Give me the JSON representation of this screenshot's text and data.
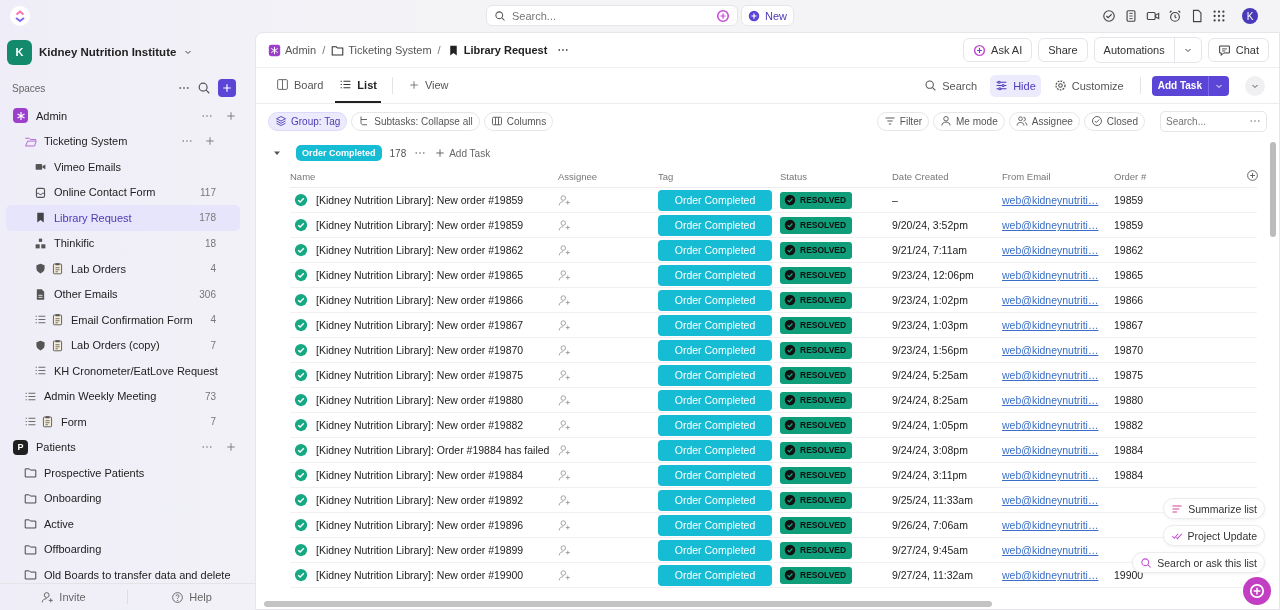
{
  "topbar": {
    "search_placeholder": "Search...",
    "new_button": "New",
    "avatar": "K"
  },
  "workspace": {
    "initial": "K",
    "name": "Kidney Nutrition Institute"
  },
  "sidebar": {
    "section": "Spaces",
    "spaces": [
      {
        "name": "Admin",
        "color": "#9c3fcb",
        "children": [
          {
            "label": "Ticketing System",
            "kind": "folder",
            "expanded": true,
            "selected": false,
            "children": [
              {
                "label": "Vimeo Emails",
                "kind": "video",
                "selected": false
              },
              {
                "label": "Online Contact Form",
                "kind": "inbox",
                "count": "117",
                "selected": false
              },
              {
                "label": "Library Request",
                "kind": "bookmark",
                "count": "178",
                "selected": true
              },
              {
                "label": "Thinkific",
                "kind": "tree",
                "count": "18",
                "selected": false
              },
              {
                "label": "Lab Orders",
                "kind": "shield",
                "form": true,
                "count": "4",
                "selected": false
              },
              {
                "label": "Other Emails",
                "kind": "doc",
                "count": "306",
                "selected": false
              },
              {
                "label": "Email Confirmation Form",
                "kind": "list",
                "form": true,
                "count": "4",
                "selected": false
              },
              {
                "label": "Lab Orders (copy)",
                "kind": "shield",
                "form": true,
                "count": "7",
                "selected": false
              },
              {
                "label": "KH Cronometer/EatLove Request",
                "kind": "list",
                "selected": false
              }
            ]
          },
          {
            "label": "Admin Weekly Meeting",
            "kind": "list",
            "count": "73",
            "selected": false
          },
          {
            "label": "Form",
            "kind": "list",
            "form": true,
            "count": "7",
            "selected": false
          }
        ]
      },
      {
        "name": "Patients",
        "initial": "P",
        "color": "#202020",
        "children": [
          {
            "label": "Prospective Patients",
            "kind": "folder",
            "selected": false
          },
          {
            "label": "Onboarding",
            "kind": "folder",
            "selected": false
          },
          {
            "label": "Active",
            "kind": "folder",
            "selected": false
          },
          {
            "label": "Offboarding",
            "kind": "folder",
            "selected": false
          },
          {
            "label": "Old Boards to transfer data and delete",
            "kind": "folder",
            "selected": false
          }
        ]
      }
    ]
  },
  "footer": {
    "invite": "Invite",
    "help": "Help"
  },
  "breadcrumbs": [
    {
      "label": "Admin",
      "kind": "space"
    },
    {
      "label": "Ticketing System",
      "kind": "folder"
    },
    {
      "label": "Library Request",
      "kind": "bookmark"
    }
  ],
  "breadcrumb_separator": "/",
  "header_buttons": [
    {
      "label": "Ask AI",
      "kind": "ai"
    },
    {
      "label": "Share",
      "kind": "plain"
    },
    {
      "label": "Automations",
      "kind": "split"
    },
    {
      "label": "Chat",
      "kind": "chat"
    }
  ],
  "views": [
    {
      "label": "Board",
      "kind": "board",
      "selected": false
    },
    {
      "label": "List",
      "kind": "list",
      "selected": true
    }
  ],
  "add_view": "View",
  "view_actions": [
    {
      "label": "Search",
      "kind": "search",
      "selected": false
    },
    {
      "label": "Hide",
      "kind": "sliders",
      "selected": true
    },
    {
      "label": "Customize",
      "kind": "gear",
      "selected": false
    }
  ],
  "add_task_button": "Add Task",
  "filters_left": [
    {
      "label": "Group: Tag",
      "kind": "layers",
      "selected": true
    },
    {
      "label": "Subtasks: Collapse all",
      "kind": "subtasks",
      "selected": false
    },
    {
      "label": "Columns",
      "kind": "columns",
      "selected": false
    }
  ],
  "filters_right": [
    {
      "label": "Filter",
      "kind": "filter"
    },
    {
      "label": "Me mode",
      "kind": "person"
    },
    {
      "label": "Assignee",
      "kind": "people"
    },
    {
      "label": "Closed",
      "kind": "check"
    }
  ],
  "list_search_placeholder": "Search...",
  "group": {
    "label": "Order Completed",
    "count": "178",
    "add": "Add Task"
  },
  "columns": [
    "Name",
    "Assignee",
    "Tag",
    "Status",
    "Date Created",
    "From Email",
    "Order #"
  ],
  "rows": [
    {
      "name": "[Kidney Nutrition Library]: New order #19859",
      "tag": "Order Completed",
      "status": "RESOLVED",
      "date": "–",
      "email": "web@kidneynutriti…",
      "order": "19859"
    },
    {
      "name": "[Kidney Nutrition Library]: New order #19859",
      "tag": "Order Completed",
      "status": "RESOLVED",
      "date": "9/20/24, 3:52pm",
      "email": "web@kidneynutriti…",
      "order": "19859"
    },
    {
      "name": "[Kidney Nutrition Library]: New order #19862",
      "tag": "Order Completed",
      "status": "RESOLVED",
      "date": "9/21/24, 7:11am",
      "email": "web@kidneynutriti…",
      "order": "19862"
    },
    {
      "name": "[Kidney Nutrition Library]: New order #19865",
      "tag": "Order Completed",
      "status": "RESOLVED",
      "date": "9/23/24, 12:06pm",
      "email": "web@kidneynutriti…",
      "order": "19865"
    },
    {
      "name": "[Kidney Nutrition Library]: New order #19866",
      "tag": "Order Completed",
      "status": "RESOLVED",
      "date": "9/23/24, 1:02pm",
      "email": "web@kidneynutriti…",
      "order": "19866"
    },
    {
      "name": "[Kidney Nutrition Library]: New order #19867",
      "tag": "Order Completed",
      "status": "RESOLVED",
      "date": "9/23/24, 1:03pm",
      "email": "web@kidneynutriti…",
      "order": "19867"
    },
    {
      "name": "[Kidney Nutrition Library]: New order #19870",
      "tag": "Order Completed",
      "status": "RESOLVED",
      "date": "9/23/24, 1:56pm",
      "email": "web@kidneynutriti…",
      "order": "19870"
    },
    {
      "name": "[Kidney Nutrition Library]: New order #19875",
      "tag": "Order Completed",
      "status": "RESOLVED",
      "date": "9/24/24, 5:25am",
      "email": "web@kidneynutriti…",
      "order": "19875"
    },
    {
      "name": "[Kidney Nutrition Library]: New order #19880",
      "tag": "Order Completed",
      "status": "RESOLVED",
      "date": "9/24/24, 8:25am",
      "email": "web@kidneynutriti…",
      "order": "19880"
    },
    {
      "name": "[Kidney Nutrition Library]: New order #19882",
      "tag": "Order Completed",
      "status": "RESOLVED",
      "date": "9/24/24, 1:05pm",
      "email": "web@kidneynutriti…",
      "order": "19882"
    },
    {
      "name": "[Kidney Nutrition Library]: Order #19884 has failed",
      "tag": "Order Completed",
      "status": "RESOLVED",
      "date": "9/24/24, 3:08pm",
      "email": "web@kidneynutriti…",
      "order": "19884"
    },
    {
      "name": "[Kidney Nutrition Library]: New order #19884",
      "tag": "Order Completed",
      "status": "RESOLVED",
      "date": "9/24/24, 3:11pm",
      "email": "web@kidneynutriti…",
      "order": "19884"
    },
    {
      "name": "[Kidney Nutrition Library]: New order #19892",
      "tag": "Order Completed",
      "status": "RESOLVED",
      "date": "9/25/24, 11:33am",
      "email": "web@kidneynutriti…"
    },
    {
      "name": "[Kidney Nutrition Library]: New order #19896",
      "tag": "Order Completed",
      "status": "RESOLVED",
      "date": "9/26/24, 7:06am",
      "email": "web@kidneynutriti…"
    },
    {
      "name": "[Kidney Nutrition Library]: New order #19899",
      "tag": "Order Completed",
      "status": "RESOLVED",
      "date": "9/27/24, 9:45am",
      "email": "web@kidneynutriti…"
    },
    {
      "name": "[Kidney Nutrition Library]: New order #19900",
      "tag": "Order Completed",
      "status": "RESOLVED",
      "date": "9/27/24, 11:32am",
      "email": "web@kidneynutriti…",
      "order": "19900"
    }
  ],
  "ai_actions": [
    {
      "label": "Summarize list",
      "kind": "lines"
    },
    {
      "label": "Project Update",
      "kind": "ticks"
    },
    {
      "label": "Search or ask this list",
      "kind": "search"
    }
  ]
}
